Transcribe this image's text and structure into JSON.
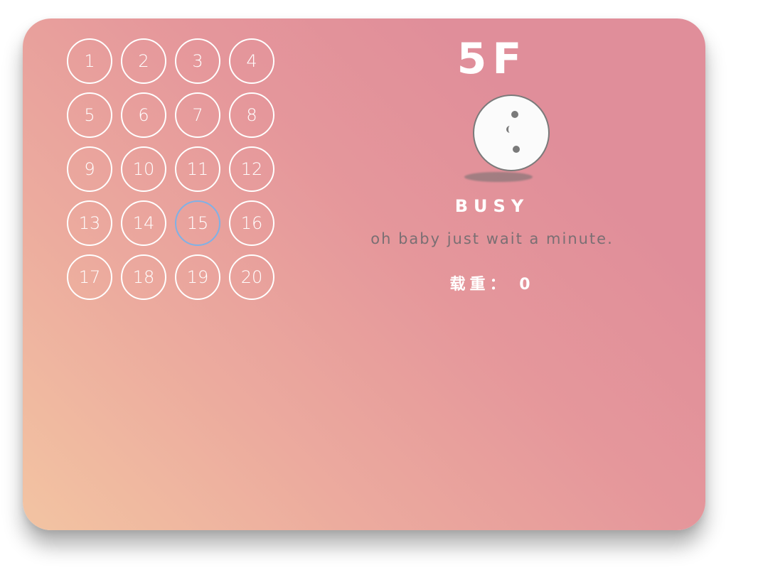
{
  "elevator": {
    "floors": [
      "1",
      "2",
      "3",
      "4",
      "5",
      "6",
      "7",
      "8",
      "9",
      "10",
      "11",
      "12",
      "13",
      "14",
      "15",
      "16",
      "17",
      "18",
      "19",
      "20"
    ],
    "current_floor": "5F",
    "status": "BUSY",
    "message": "oh baby just wait a minute.",
    "load_label": "载重：",
    "load_value": "0",
    "active_button": "15"
  },
  "colors": {
    "gradient_start": "#f3c4a2",
    "gradient_end": "#e08e9a",
    "button_border": "#ffffff",
    "active_button_border": "#7fb1e6",
    "face_fill": "#fbfbfb",
    "face_features": "#7a7a7a",
    "message_text": "#7a6f73"
  },
  "icons": {
    "status_face": "busy-face-icon"
  }
}
